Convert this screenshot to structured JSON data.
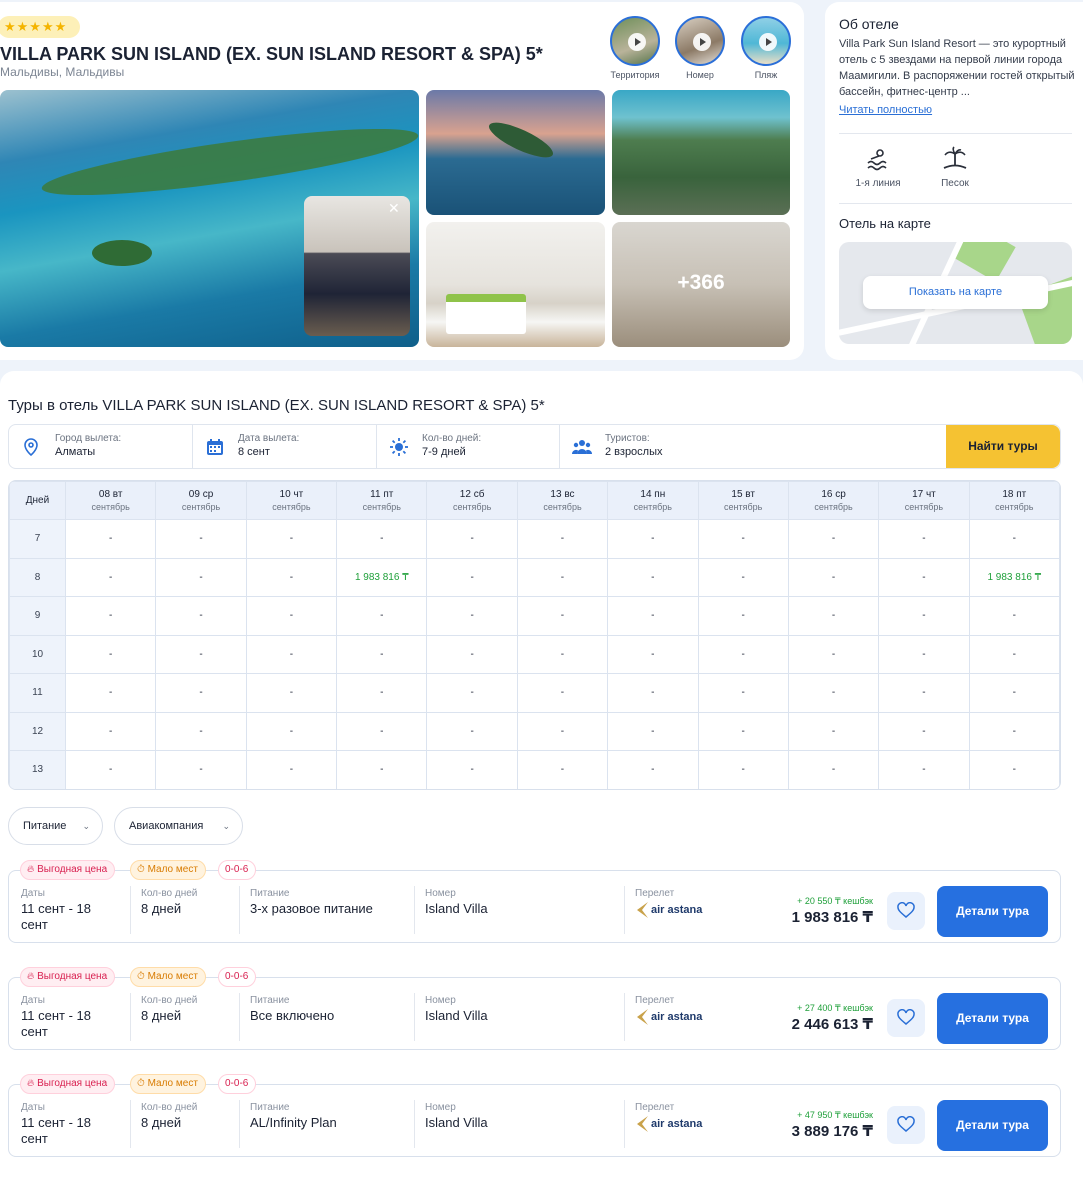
{
  "hotel": {
    "stars": "★★★★★",
    "name": "VILLA PARK SUN ISLAND (EX. SUN ISLAND RESORT & SPA) 5*",
    "location": "Мальдивы, Мальдивы",
    "videos": [
      {
        "label": "Территория",
        "icon": "play-icon"
      },
      {
        "label": "Номер",
        "icon": "play-icon"
      },
      {
        "label": "Пляж",
        "icon": "play-icon"
      }
    ],
    "photo_more": "+366",
    "close_icon": "✕"
  },
  "about": {
    "title": "Об отеле",
    "text": "Villa Park Sun Island Resort — это курортный отель с 5 звездами на первой линии города Маамигили. В распоряжении гостей открытый бассейн, фитнес-центр ...",
    "read_more": "Читать полностью",
    "features": [
      {
        "label": "1-я линия",
        "icon": "beach-wave-icon"
      },
      {
        "label": "Песок",
        "icon": "palm-island-icon"
      }
    ],
    "map_title": "Отель на карте",
    "map_button": "Показать на карте"
  },
  "tours": {
    "title": "Туры в отель VILLA PARK SUN ISLAND (EX. SUN ISLAND RESORT & SPA) 5*",
    "search": {
      "city_label": "Город вылета:",
      "city_value": "Алматы",
      "date_label": "Дата вылета:",
      "date_value": "8 сент",
      "days_label": "Кол-во дней:",
      "days_value": "7-9 дней",
      "tourists_label": "Туристов:",
      "tourists_value": "2 взрослых",
      "find_button": "Найти туры"
    },
    "calendar": {
      "corner": "Дней",
      "columns": [
        {
          "day": "08 вт",
          "month": "сентябрь"
        },
        {
          "day": "09 ср",
          "month": "сентябрь"
        },
        {
          "day": "10 чт",
          "month": "сентябрь"
        },
        {
          "day": "11 пт",
          "month": "сентябрь"
        },
        {
          "day": "12 сб",
          "month": "сентябрь"
        },
        {
          "day": "13 вс",
          "month": "сентябрь"
        },
        {
          "day": "14 пн",
          "month": "сентябрь"
        },
        {
          "day": "15 вт",
          "month": "сентябрь"
        },
        {
          "day": "16 ср",
          "month": "сентябрь"
        },
        {
          "day": "17 чт",
          "month": "сентябрь"
        },
        {
          "day": "18 пт",
          "month": "сентябрь"
        }
      ],
      "rows": [
        {
          "nights": "7",
          "cells": [
            "-",
            "-",
            "-",
            "-",
            "-",
            "-",
            "-",
            "-",
            "-",
            "-",
            "-"
          ]
        },
        {
          "nights": "8",
          "cells": [
            "-",
            "-",
            "-",
            "1 983 816 ₸",
            "-",
            "-",
            "-",
            "-",
            "-",
            "-",
            "1 983 816 ₸"
          ]
        },
        {
          "nights": "9",
          "cells": [
            "-",
            "-",
            "-",
            "-",
            "-",
            "-",
            "-",
            "-",
            "-",
            "-",
            "-"
          ]
        },
        {
          "nights": "10",
          "cells": [
            "-",
            "-",
            "-",
            "-",
            "-",
            "-",
            "-",
            "-",
            "-",
            "-",
            "-"
          ]
        },
        {
          "nights": "11",
          "cells": [
            "-",
            "-",
            "-",
            "-",
            "-",
            "-",
            "-",
            "-",
            "-",
            "-",
            "-"
          ]
        },
        {
          "nights": "12",
          "cells": [
            "-",
            "-",
            "-",
            "-",
            "-",
            "-",
            "-",
            "-",
            "-",
            "-",
            "-"
          ]
        },
        {
          "nights": "13",
          "cells": [
            "-",
            "-",
            "-",
            "-",
            "-",
            "-",
            "-",
            "-",
            "-",
            "-",
            "-"
          ]
        }
      ]
    },
    "filters": {
      "meal": "Питание",
      "airline": "Авиакомпания"
    },
    "offers": [
      {
        "badge_hot": "Выгодная цена",
        "badge_few": "Мало мест",
        "badge_code": "0-0-6",
        "dates_label": "Даты",
        "dates": "11 сент - 18 сент",
        "days_label": "Кол-во дней",
        "days": "8 дней",
        "meal_label": "Питание",
        "meal": "3-х разовое питание",
        "room_label": "Номер",
        "room": "Island Villa",
        "flight_label": "Перелет",
        "airline": "air astana",
        "cashback": "+ 20 550 ₸ кешбэк",
        "price": "1 983 816 ₸",
        "details": "Детали тура"
      },
      {
        "badge_hot": "Выгодная цена",
        "badge_few": "Мало мест",
        "badge_code": "0-0-6",
        "dates_label": "Даты",
        "dates": "11 сент - 18 сент",
        "days_label": "Кол-во дней",
        "days": "8 дней",
        "meal_label": "Питание",
        "meal": "Все включено",
        "room_label": "Номер",
        "room": "Island Villa",
        "flight_label": "Перелет",
        "airline": "air astana",
        "cashback": "+ 27 400 ₸ кешбэк",
        "price": "2 446 613 ₸",
        "details": "Детали тура"
      },
      {
        "badge_hot": "Выгодная цена",
        "badge_few": "Мало мест",
        "badge_code": "0-0-6",
        "dates_label": "Даты",
        "dates": "11 сент - 18 сент",
        "days_label": "Кол-во дней",
        "days": "8 дней",
        "meal_label": "Питание",
        "meal": "AL/Infinity Plan",
        "room_label": "Номер",
        "room": "Island Villa",
        "flight_label": "Перелет",
        "airline": "air astana",
        "cashback": "+ 47 950 ₸ кешбэк",
        "price": "3 889 176 ₸",
        "details": "Детали тура"
      }
    ]
  },
  "colors": {
    "accent": "#2670e0",
    "cta": "#f5c232",
    "price_green": "#1fa03a",
    "hot": "#d81f4f"
  }
}
